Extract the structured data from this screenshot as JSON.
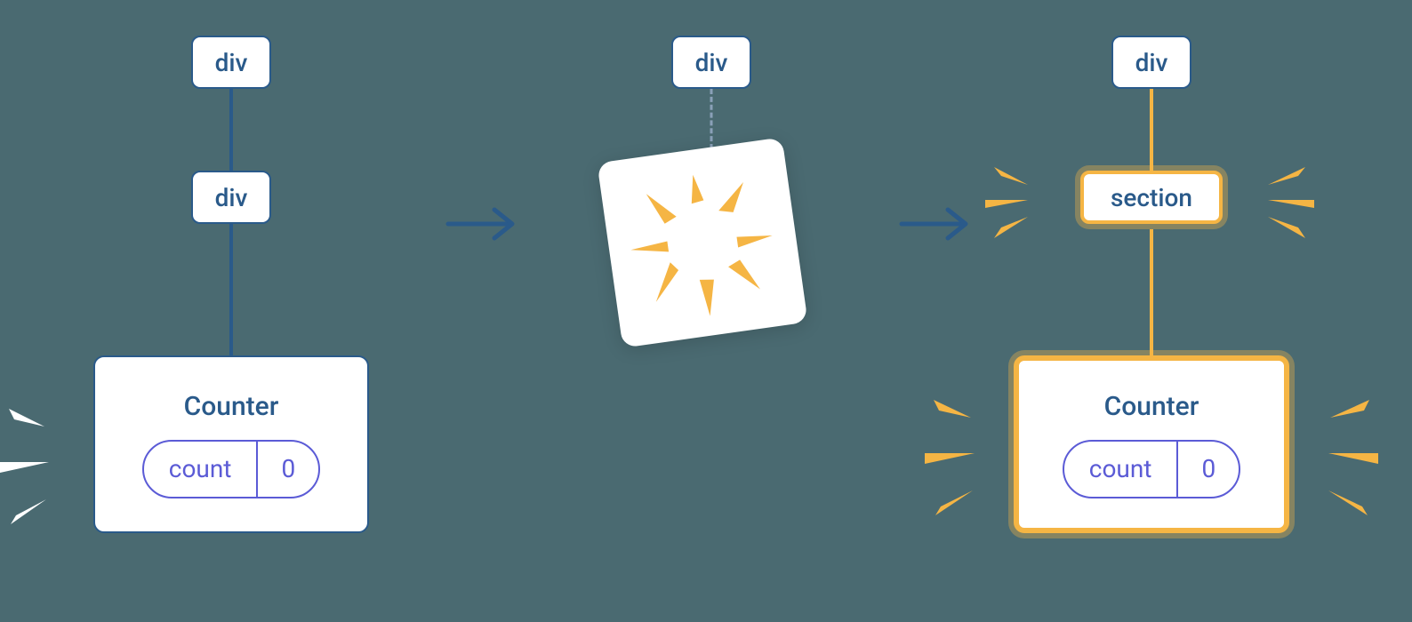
{
  "stage1": {
    "node1": "div",
    "node2": "div",
    "counter": {
      "title": "Counter",
      "state_label": "count",
      "state_value": "0"
    }
  },
  "stage2": {
    "node1": "div"
  },
  "stage3": {
    "node1": "div",
    "node2": "section",
    "counter": {
      "title": "Counter",
      "state_label": "count",
      "state_value": "0"
    }
  },
  "colors": {
    "primary": "#2a5a8a",
    "accent": "#f5b544",
    "state": "#5b5bd6",
    "bg": "#4a6a71"
  }
}
